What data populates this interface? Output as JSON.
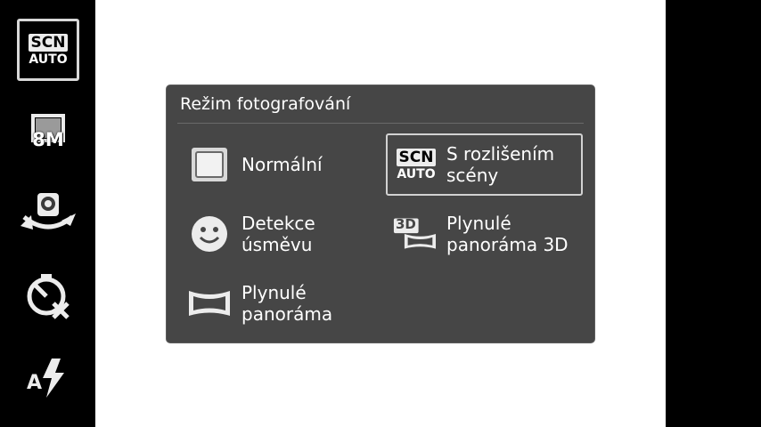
{
  "sidebar": {
    "scene_auto": {
      "top": "SCN",
      "bottom": "AUTO",
      "icon": "scene-auto-icon"
    },
    "resolution": {
      "label": "8M",
      "icon": "resolution-icon"
    },
    "camera_switch": {
      "icon": "camera-switch-icon"
    },
    "self_timer": {
      "icon": "self-timer-off-icon"
    },
    "flash": {
      "label": "A",
      "icon": "flash-auto-icon"
    }
  },
  "dialog": {
    "title": "Režim fotografování",
    "options": [
      {
        "label": "Normální",
        "icon": "normal-mode-icon"
      },
      {
        "label": "S rozlišením scény",
        "line1": "S rozlišením",
        "line2": "scény",
        "icon_top": "SCN",
        "icon_bottom": "AUTO",
        "selected": true
      },
      {
        "label": "Detekce úsměvu",
        "line1": "Detekce",
        "line2": "úsměvu",
        "icon": "smile-icon"
      },
      {
        "label": "Plynulé panoráma 3D",
        "line1": "Plynulé",
        "line2": "panoráma 3D",
        "icon_text": "3D"
      },
      {
        "label": "Plynulé panoráma",
        "line1": "Plynulé",
        "line2": "panoráma",
        "icon": "panorama-icon"
      }
    ]
  },
  "colors": {
    "dialog_bg": "#464646",
    "bars": "#000000",
    "viewfinder": "#ffffff"
  }
}
